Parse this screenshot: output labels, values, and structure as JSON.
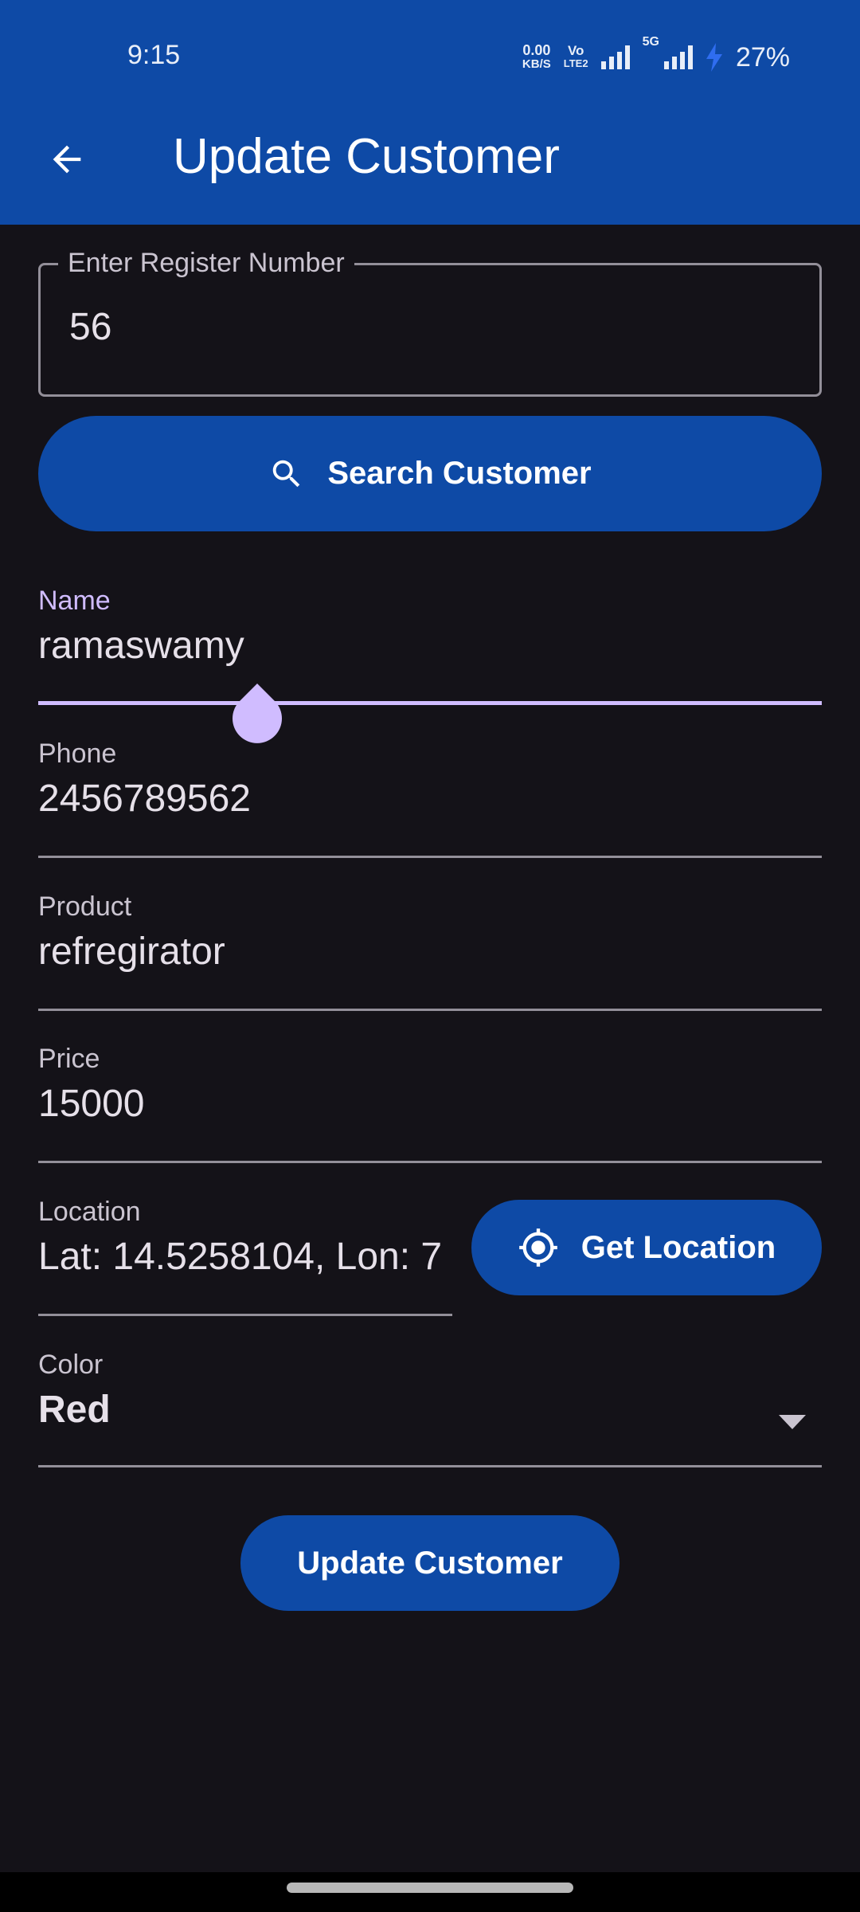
{
  "status_bar": {
    "time": "9:15",
    "net_speed_value": "0.00",
    "net_speed_unit": "KB/S",
    "volte_top": "Vo",
    "volte_bottom": "LTE2",
    "network_type": "5G",
    "battery_percent": "27%",
    "icons": [
      "signal-icon",
      "signal-5g-icon",
      "charging-bolt-icon"
    ]
  },
  "app_bar": {
    "title": "Update Customer",
    "back_icon": "arrow-back-icon",
    "background_color": "#0e4aa6"
  },
  "register_field": {
    "label": "Enter Register Number",
    "value": "56"
  },
  "search_button": {
    "label": "Search Customer",
    "icon": "search-icon"
  },
  "form": {
    "name": {
      "label": "Name",
      "value": "ramaswamy"
    },
    "phone": {
      "label": "Phone",
      "value": "2456789562"
    },
    "product": {
      "label": "Product",
      "value": "refregirator"
    },
    "price": {
      "label": "Price",
      "value": "15000"
    },
    "location": {
      "label": "Location",
      "value": "Lat: 14.5258104, Lon: 7"
    },
    "color": {
      "label": "Color",
      "value": "Red",
      "icon": "dropdown-arrow-icon"
    }
  },
  "location_button": {
    "label": "Get Location",
    "icon": "my-location-icon"
  },
  "update_button": {
    "label": "Update Customer"
  },
  "colors": {
    "primary": "#0e4aa6",
    "background": "#141218",
    "focus_accent": "#d0bcff"
  }
}
